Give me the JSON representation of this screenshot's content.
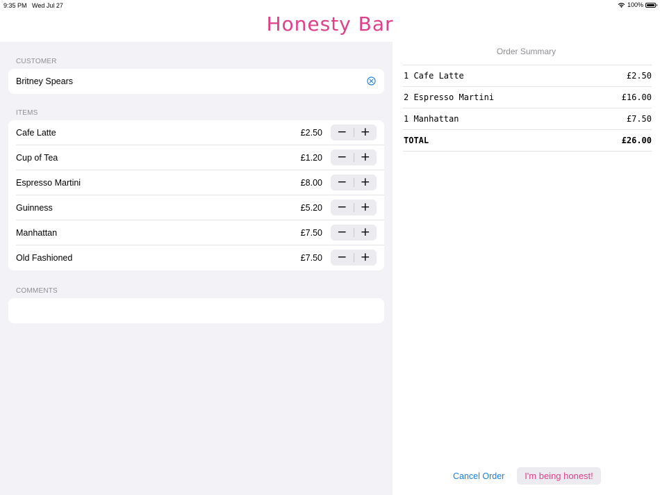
{
  "status_bar": {
    "time": "9:35 PM",
    "date": "Wed Jul 27",
    "battery": "100%"
  },
  "app": {
    "title": "Honesty Bar",
    "accent_color": "#e0408a",
    "link_color": "#1a7fe0"
  },
  "form": {
    "customer_header": "CUSTOMER",
    "customer_name": "Britney Spears",
    "items_header": "ITEMS",
    "items": [
      {
        "name": "Cafe Latte",
        "price": "£2.50"
      },
      {
        "name": "Cup of Tea",
        "price": "£1.20"
      },
      {
        "name": "Espresso Martini",
        "price": "£8.00"
      },
      {
        "name": "Guinness",
        "price": "£5.20"
      },
      {
        "name": "Manhattan",
        "price": "£7.50"
      },
      {
        "name": "Old Fashioned",
        "price": "£7.50"
      }
    ],
    "stepper": {
      "minus": "−",
      "plus": "+"
    },
    "comments_header": "COMMENTS",
    "comments_value": ""
  },
  "summary": {
    "title": "Order Summary",
    "lines": [
      {
        "desc": "1 Cafe Latte",
        "amount": "£2.50"
      },
      {
        "desc": "2 Espresso Martini",
        "amount": "£16.00"
      },
      {
        "desc": "1 Manhattan",
        "amount": "£7.50"
      }
    ],
    "total_label": "TOTAL",
    "total_amount": "£26.00"
  },
  "actions": {
    "cancel_label": "Cancel Order",
    "confirm_label": "I'm being honest!"
  },
  "icons": {
    "clear": "clear-circle-icon",
    "wifi": "wifi-icon",
    "battery": "battery-icon"
  }
}
